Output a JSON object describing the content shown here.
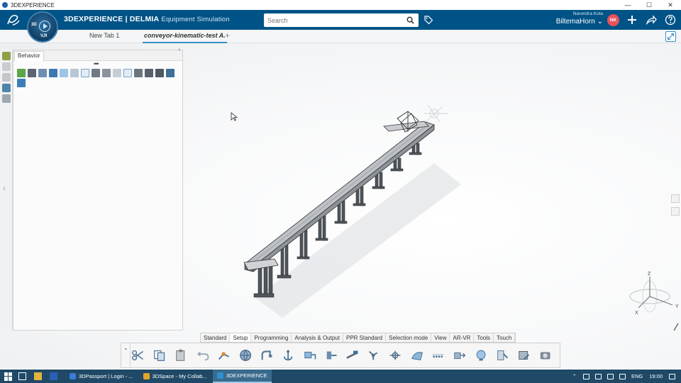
{
  "window": {
    "title": "3DEXPERIENCE",
    "controls": [
      "—",
      "☐",
      "✕"
    ]
  },
  "header": {
    "brand_main": "3DEXPERIENCE | DELMIA",
    "brand_sub": "Equipment Simulation",
    "compass_label_3d": "3D",
    "compass_label_v": "V,R",
    "search_placeholder": "Search",
    "user_name": "Narendra Kota",
    "tenant": "BiltemaHorn",
    "avatar_initials": "NK"
  },
  "tabs": [
    {
      "label": "New Tab 1",
      "active": false
    },
    {
      "label": "conveyor-kinematic-test A.",
      "active": true
    }
  ],
  "tab_add_label": "+",
  "panel": {
    "tab_label": "Behavior",
    "collapse_label": "‹",
    "dots": "•••"
  },
  "section_tabs": [
    "Standard",
    "Setup",
    "Programming",
    "Analysis & Output",
    "PPR Standard",
    "Selection mode",
    "View",
    "AR-VR",
    "Tools",
    "Touch"
  ],
  "active_section": "Setup",
  "action_bar": {
    "collapse_glyph": "⌄"
  },
  "compass_axes": {
    "z": "Z",
    "x": "X",
    "y": "Y"
  },
  "taskbar": {
    "tasks": [
      {
        "label": "3DPassport | Login - ...",
        "color": "#3a7bd5"
      },
      {
        "label": "3DSpace - My Collab...",
        "color": "#e2a52b"
      },
      {
        "label": "3DEXPERIENCE",
        "color": "#2f8fd0"
      }
    ],
    "language": "ENG",
    "clock": "19:00"
  },
  "colors": {
    "header_bg": "#005386",
    "accent": "#368ec4",
    "taskbar_bg": "#1f4966"
  }
}
